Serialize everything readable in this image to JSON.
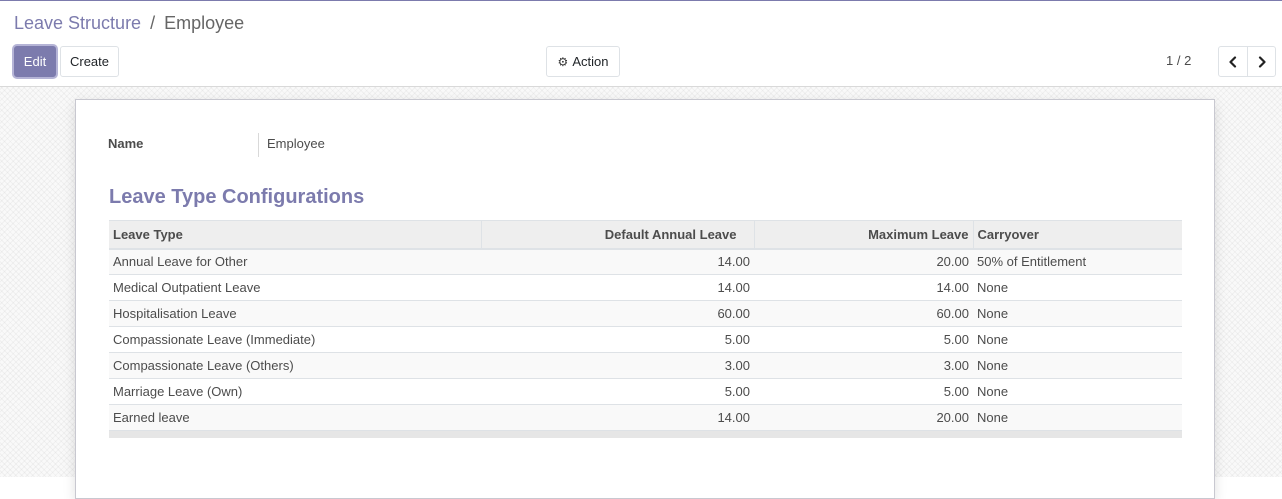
{
  "breadcrumb": {
    "parent": "Leave Structure",
    "separator": "/",
    "current": "Employee"
  },
  "toolbar": {
    "edit_label": "Edit",
    "create_label": "Create",
    "action_label": "Action",
    "action_icon": "gear-icon"
  },
  "pager": {
    "value": "1 / 2",
    "prev_icon": "chevron-left-icon",
    "next_icon": "chevron-right-icon"
  },
  "colors": {
    "brand": "#7c7bad"
  },
  "form": {
    "name_label": "Name",
    "name_value": "Employee",
    "section_title": "Leave Type Configurations",
    "table": {
      "headers": [
        "Leave Type",
        "Default Annual Leave",
        "Maximum Leave",
        "Carryover"
      ],
      "rows": [
        {
          "type": "Annual Leave for Other",
          "default": "14.00",
          "max": "20.00",
          "carry": "50% of Entitlement"
        },
        {
          "type": "Medical Outpatient Leave",
          "default": "14.00",
          "max": "14.00",
          "carry": "None"
        },
        {
          "type": "Hospitalisation Leave",
          "default": "60.00",
          "max": "60.00",
          "carry": "None"
        },
        {
          "type": "Compassionate Leave (Immediate)",
          "default": "5.00",
          "max": "5.00",
          "carry": "None"
        },
        {
          "type": "Compassionate Leave (Others)",
          "default": "3.00",
          "max": "3.00",
          "carry": "None"
        },
        {
          "type": "Marriage Leave (Own)",
          "default": "5.00",
          "max": "5.00",
          "carry": "None"
        },
        {
          "type": "Earned leave",
          "default": "14.00",
          "max": "20.00",
          "carry": "None"
        }
      ]
    }
  }
}
